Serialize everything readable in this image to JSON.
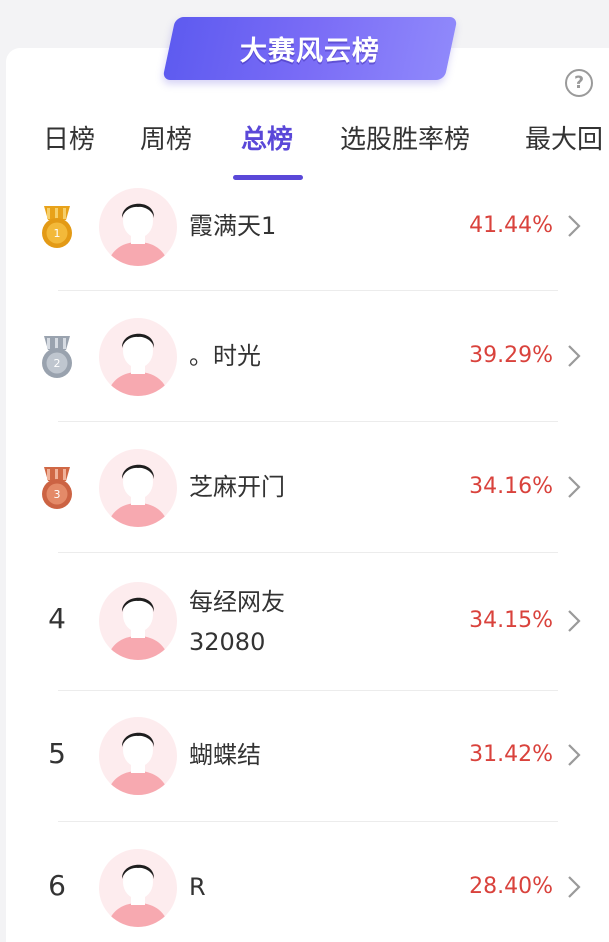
{
  "header": {
    "title": "大赛风云榜",
    "help": "?"
  },
  "tabs": [
    {
      "label": "日榜",
      "active": false
    },
    {
      "label": "周榜",
      "active": false
    },
    {
      "label": "总榜",
      "active": true
    },
    {
      "label": "选股胜率榜",
      "active": false
    },
    {
      "label": "最大回",
      "active": false
    }
  ],
  "colors": {
    "accent": "#5a48d8",
    "percent": "#d9423c",
    "gold": "#e8a21a",
    "silver": "#a9b1bd",
    "bronze": "#d8734f"
  },
  "leaderboard": [
    {
      "rank": "1",
      "medal": "gold-medal-icon",
      "name": "霞满天1",
      "name2": "",
      "value": "41.44%"
    },
    {
      "rank": "2",
      "medal": "silver-medal-icon",
      "name": "。时光",
      "name2": "",
      "value": "39.29%"
    },
    {
      "rank": "3",
      "medal": "bronze-medal-icon",
      "name": "芝麻开门",
      "name2": "",
      "value": "34.16%"
    },
    {
      "rank": "4",
      "medal": "",
      "name": "每经网友",
      "name2": "32080",
      "value": "34.15%"
    },
    {
      "rank": "5",
      "medal": "",
      "name": "蝴蝶结",
      "name2": "",
      "value": "31.42%"
    },
    {
      "rank": "6",
      "medal": "",
      "name": "R",
      "name2": "",
      "value": "28.40%"
    }
  ]
}
